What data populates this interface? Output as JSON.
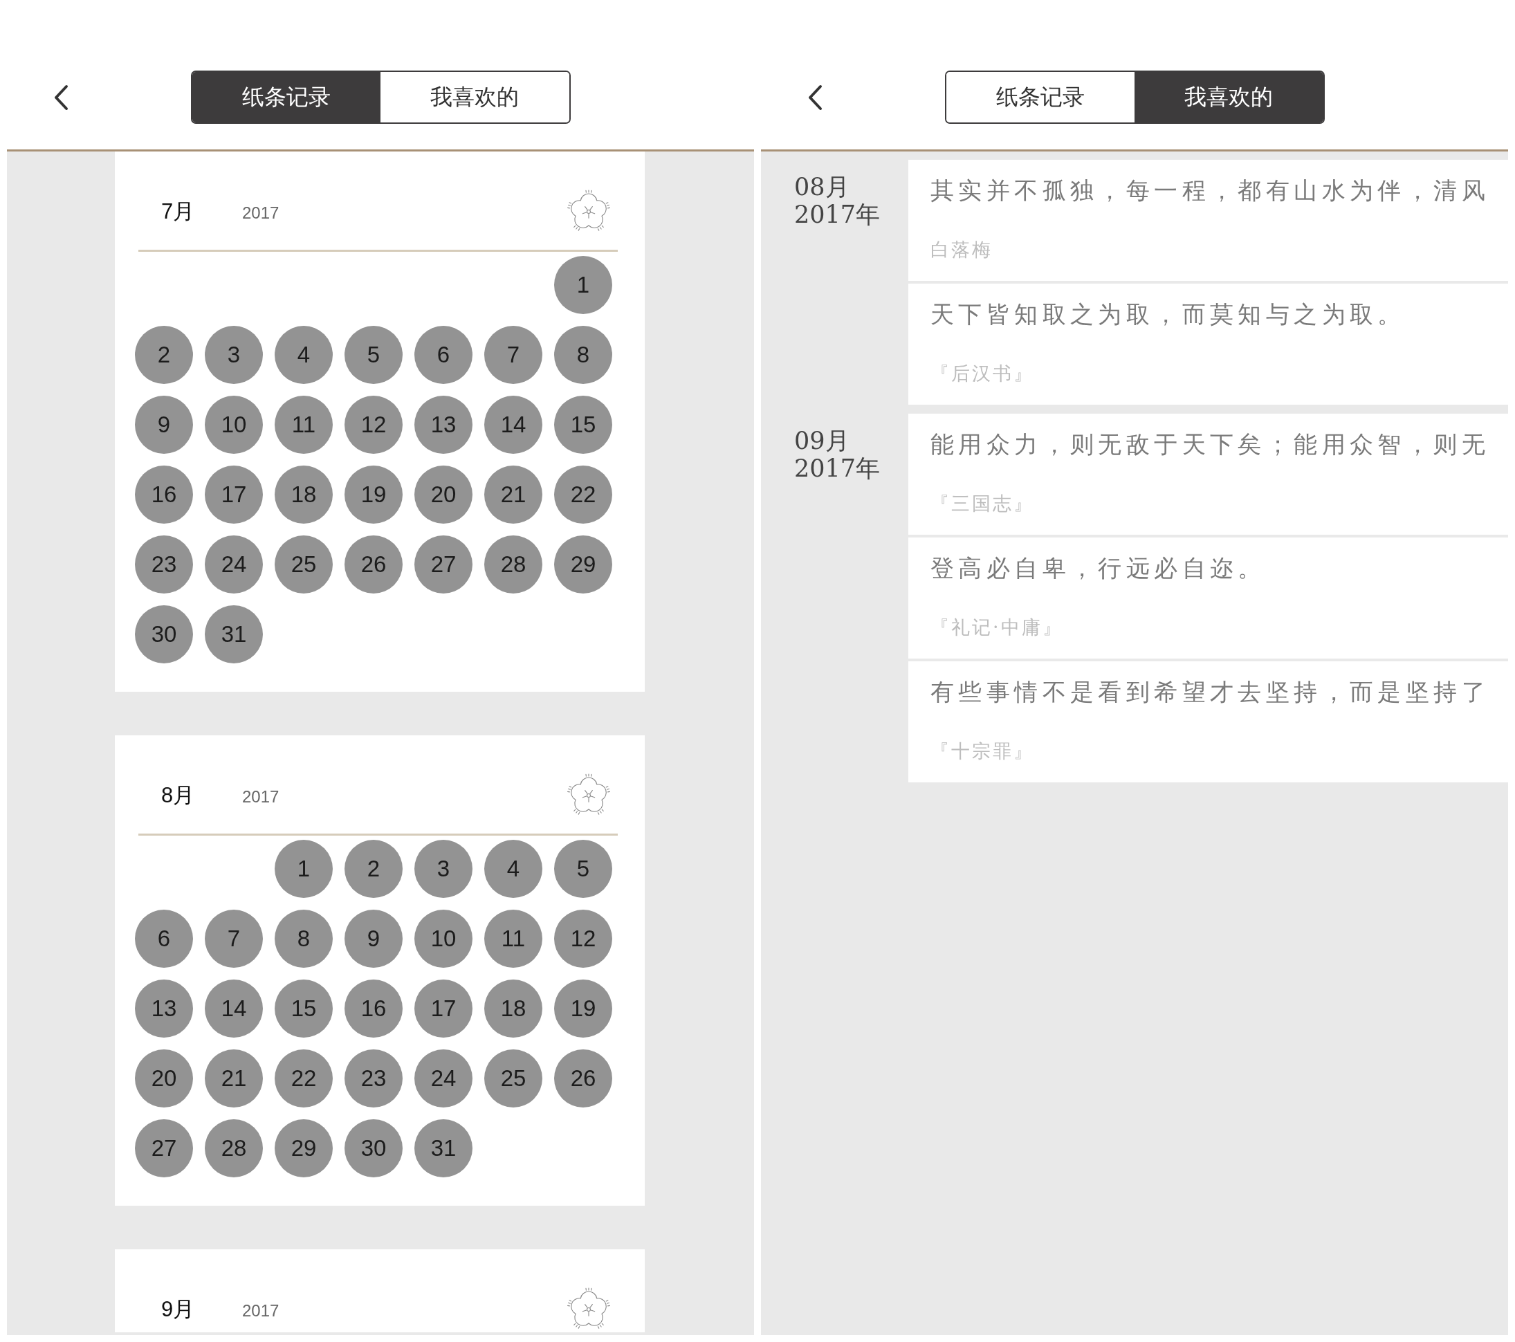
{
  "screens": [
    {
      "kind": "calendar",
      "tabs": [
        {
          "label": "纸条记录",
          "selected": true
        },
        {
          "label": "我喜欢的",
          "selected": false
        }
      ],
      "months": [
        {
          "month": "7月",
          "year": "2017",
          "weeks": [
            [
              "1"
            ],
            [
              "2",
              "3",
              "4",
              "5",
              "6",
              "7",
              "8"
            ],
            [
              "9",
              "10",
              "11",
              "12",
              "13",
              "14",
              "15"
            ],
            [
              "16",
              "17",
              "18",
              "19",
              "20",
              "21",
              "22"
            ],
            [
              "23",
              "24",
              "25",
              "26",
              "27",
              "28",
              "29"
            ],
            [
              "30",
              "31"
            ]
          ]
        },
        {
          "month": "8月",
          "year": "2017",
          "weeks": [
            [
              "1",
              "2",
              "3",
              "4",
              "5"
            ],
            [
              "6",
              "7",
              "8",
              "9",
              "10",
              "11",
              "12"
            ],
            [
              "13",
              "14",
              "15",
              "16",
              "17",
              "18",
              "19"
            ],
            [
              "20",
              "21",
              "22",
              "23",
              "24",
              "25",
              "26"
            ],
            [
              "27",
              "28",
              "29",
              "30",
              "31"
            ]
          ]
        },
        {
          "month": "9月",
          "year": "2017"
        }
      ]
    },
    {
      "kind": "favorites",
      "tabs": [
        {
          "label": "纸条记录",
          "selected": false
        },
        {
          "label": "我喜欢的",
          "selected": true
        }
      ],
      "groups": [
        {
          "month": "08月",
          "year": "2017年",
          "entries": [
            {
              "quote": "其实并不孤独，每一程，都有山水为伴，清风",
              "source": "白落梅"
            },
            {
              "quote": "天下皆知取之为取，而莫知与之为取。",
              "source": "『后汉书』"
            }
          ]
        },
        {
          "month": "09月",
          "year": "2017年",
          "entries": [
            {
              "quote": "能用众力，则无敌于天下矣；能用众智，则无",
              "source": "『三国志』"
            },
            {
              "quote": "登高必自卑，行远必自迩。",
              "source": "『礼记·中庸』"
            },
            {
              "quote": "有些事情不是看到希望才去坚持，而是坚持了",
              "source": "『十宗罪』"
            }
          ]
        }
      ]
    }
  ]
}
